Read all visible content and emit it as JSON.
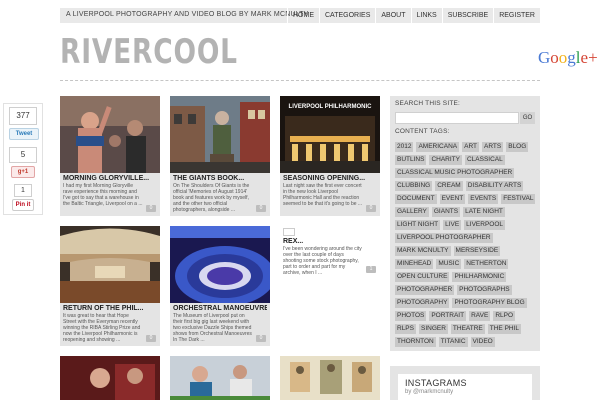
{
  "header": {
    "tagline": "A Liverpool Photography and Video Blog by Mark McNulty",
    "nav": [
      "HOME",
      "CATEGORIES",
      "ABOUT",
      "LINKS",
      "SUBSCRIBE",
      "REGISTER"
    ],
    "logo": "RIVERCOOL",
    "google_plus": {
      "g": "G",
      "o1": "o",
      "o2": "o",
      "g2": "g",
      "l": "l",
      "e": "e",
      "plus": "+"
    }
  },
  "social": {
    "share_count": "377",
    "tweet_label": "Tweet",
    "gplus_count": "5",
    "gplus_label": "g+1",
    "pin_count": "1",
    "pin_label": "Pin it"
  },
  "posts": [
    {
      "title": "MORNING GLORYVILLE...",
      "excerpt": "I had my first Morning Gloryville rave experience this morning and I've got to say that a warehouse in the Baltic Triangle, Liverpool on a ...",
      "comments": "0"
    },
    {
      "title": "THE GIANTS BOOK...",
      "excerpt": "On The Shoulders Of Giants is the official 'Memories of August 1914' book and features work by myself, and the other two official photographers, alongside ...",
      "comments": "0"
    },
    {
      "title": "SEASONING OPENING...",
      "excerpt": "Last night saw the first ever concert in the new look Liverpool Philharmonic Hall and the reaction seemed to be that it's going to be ...",
      "comments": "0"
    },
    {
      "title": "RETURN OF THE PHIL...",
      "excerpt": "It was great to hear that Hope Street with the Everyman recently winning the RIBA Stirling Prize and now the Liverpool Philharmonic is reopening and showing ...",
      "comments": "0"
    },
    {
      "title": "ORCHESTRAL MANOEUVRE...",
      "excerpt": "The Museum of Liverpool put on their first big gig last weekend with two exclusive Dazzle Ships themed shows from Orchestral Manoeuvres In The Dark ...",
      "comments": "0"
    },
    {
      "title": "REX...",
      "excerpt": "I've been wondering around the city over the last couple of days shooting some stock photography, part to order and part for my archive, when I ...",
      "comments": "1"
    }
  ],
  "thumb_text": {
    "phil_sign": "LIVERPOOL PHILHARMONIC"
  },
  "sidebar": {
    "search_label": "SEARCH THIS SITE:",
    "go_label": "GO",
    "tags_label": "CONTENT TAGS:",
    "tags": [
      "2012",
      "AMERICANA",
      "ART",
      "ARTS",
      "BLOG",
      "BUTLINS",
      "CHARITY",
      "CLASSICAL",
      "CLASSICAL MUSIC PHOTOGRAPHER",
      "CLUBBING",
      "CREAM",
      "DISABILITY ARTS",
      "DOCUMENT",
      "EVENT",
      "EVENTS",
      "FESTIVAL",
      "GALLERY",
      "GIANTS",
      "LATE NIGHT",
      "LIGHT NIGHT",
      "LIVE",
      "LIVERPOOL",
      "LIVERPOOL PHOTOGRAPHER",
      "MARK MCNULTY",
      "MERSEYSIDE",
      "MINEHEAD",
      "MUSIC",
      "NETHERTON",
      "OPEN CULTURE",
      "PHILHARMONIC",
      "PHOTOGRAPHER",
      "PHOTOGRAPHS",
      "PHOTOGRAPHY",
      "PHOTOGRAPHY BLOG",
      "PHOTOS",
      "PORTRAIT",
      "RAVE",
      "RLPO",
      "RLPS",
      "SINGER",
      "THEATRE",
      "THE PHIL",
      "THORNTON",
      "TITANIC",
      "VIDEO"
    ]
  },
  "instagram": {
    "title": "INSTAGRAMS",
    "by": "by @markmcnulty"
  }
}
